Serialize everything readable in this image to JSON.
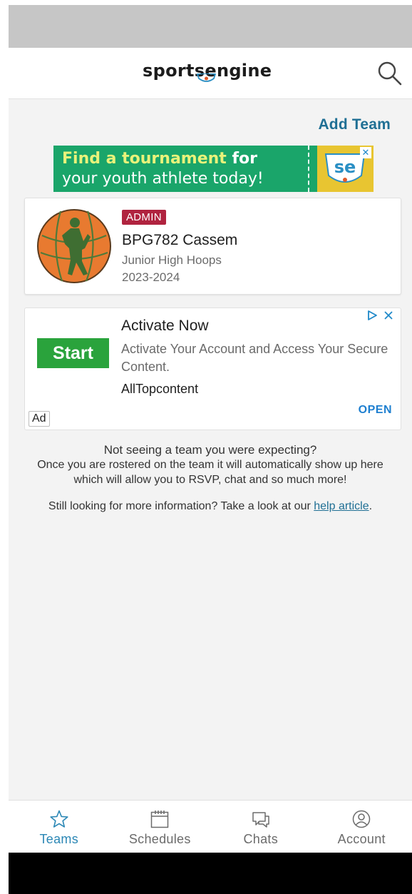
{
  "header": {
    "logo_text_pre": "sport",
    "logo_text_se": "se",
    "logo_text_post": "ngine"
  },
  "add_team_label": "Add Team",
  "promo_banner": {
    "line1_highlight": "Find a tournament",
    "line1_rest": " for",
    "line2": "your youth athlete today!",
    "badge_text": "se"
  },
  "team": {
    "badge": "ADMIN",
    "name": "BPG782 Cassem",
    "league": "Junior High Hoops",
    "season": "2023-2024"
  },
  "ad": {
    "cta": "Start",
    "title": "Activate Now",
    "description": "Activate Your Account and Access Your Secure Content.",
    "advertiser": "AllTopcontent",
    "open_label": "OPEN",
    "ad_label": "Ad"
  },
  "info": {
    "title": "Not seeing a team you were expecting?",
    "body_line1": "Once you are rostered on the team it will automatically show up here",
    "body_line2": "which will allow you to RSVP, chat and so much more!",
    "help_prefix": "Still looking for more information? Take a look at our ",
    "help_link": "help article",
    "help_suffix": "."
  },
  "tabs": [
    {
      "label": "Teams",
      "icon": "star-icon",
      "active": true
    },
    {
      "label": "Schedules",
      "icon": "calendar-icon",
      "active": false
    },
    {
      "label": "Chats",
      "icon": "chat-icon",
      "active": false
    },
    {
      "label": "Account",
      "icon": "user-circle-icon",
      "active": false
    }
  ],
  "colors": {
    "accent": "#2b87b5",
    "link": "#1f6f94",
    "admin_badge": "#b0233f",
    "banner_green": "#1aa56a",
    "ad_button": "#2aa33c",
    "avatar_orange": "#e87a30"
  }
}
